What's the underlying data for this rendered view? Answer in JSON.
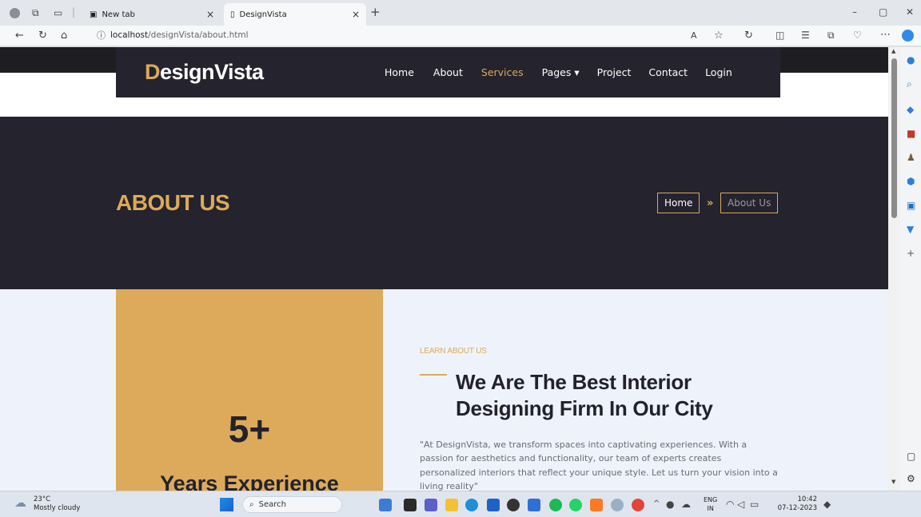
{
  "browser": {
    "tabs": [
      {
        "label": "New tab"
      },
      {
        "label": "DesignVista"
      }
    ],
    "address": {
      "host": "localhost",
      "path": "/designVista/about.html"
    },
    "new_tab_glyph": "+",
    "close_glyph": "×",
    "window": {
      "minimize": "–",
      "restore": "▢",
      "close": "✕"
    }
  },
  "site": {
    "brand_first": "D",
    "brand_rest": "esignVista",
    "nav": [
      {
        "label": "Home"
      },
      {
        "label": "About"
      },
      {
        "label": "Services",
        "active": true
      },
      {
        "label": "Pages ▾"
      },
      {
        "label": "Project"
      },
      {
        "label": "Contact"
      },
      {
        "label": "Login"
      }
    ],
    "hero_title": "ABOUT US",
    "breadcrumb_home": "Home",
    "breadcrumb_sep": "»",
    "breadcrumb_current": "About Us",
    "experience_number": "5+",
    "experience_label": "Years Experience",
    "section_label": "LEARN ABOUT US",
    "section_heading": "We Are The Best Interior Designing Firm In Our City",
    "section_text": "\"At DesignVista, we transform spaces into captivating experiences. With a passion for aesthetics and functionality, our team of experts creates personalized interiors that reflect your unique style. Let us turn your vision into a living reality\""
  },
  "taskbar": {
    "weather_temp": "23°C",
    "weather_desc": "Mostly cloudy",
    "search_label": "Search",
    "lang_top": "ENG",
    "lang_bottom": "IN",
    "time": "10:42",
    "date": "07-12-2023"
  },
  "colors": {
    "accent": "#dcaa5a",
    "dark": "#24232e",
    "light_bg": "#eef3fb"
  }
}
